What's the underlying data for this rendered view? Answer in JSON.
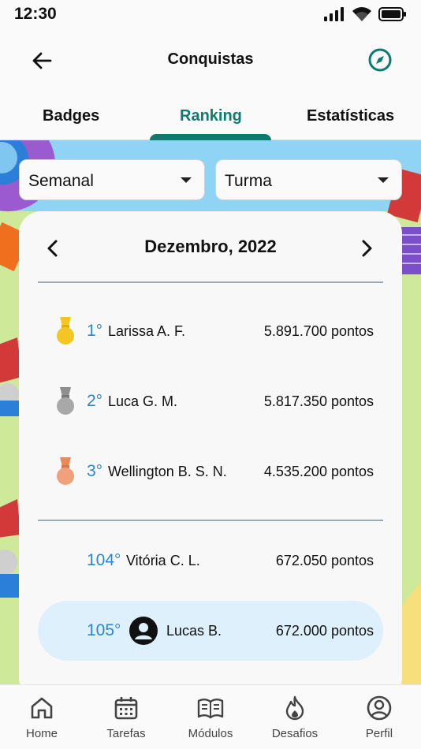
{
  "status_bar": {
    "time": "12:30"
  },
  "app_bar": {
    "title": "Conquistas"
  },
  "tabs": [
    {
      "label": "Badges",
      "active": false
    },
    {
      "label": "Ranking",
      "active": true
    },
    {
      "label": "Estatísticas",
      "active": false
    }
  ],
  "filters": {
    "period": "Semanal",
    "group": "Turma"
  },
  "ranking": {
    "month": "Dezembro, 2022",
    "top": [
      {
        "position": "1°",
        "name": "Larissa A. F.",
        "points": "5.891.700 pontos",
        "medal": "gold-medal-icon",
        "medal_color": "#f3c623"
      },
      {
        "position": "2°",
        "name": "Luca G. M.",
        "points": "5.817.350 pontos",
        "medal": "silver-medal-icon",
        "medal_color": "#a8a8a8"
      },
      {
        "position": "3°",
        "name": "Wellington B. S. N.",
        "points": "4.535.200 pontos",
        "medal": "bronze-medal-icon",
        "medal_color": "#f0a07a"
      }
    ],
    "others": [
      {
        "position": "104°",
        "name": "Vitória C. L.",
        "points": "672.050 pontos"
      },
      {
        "position": "105°",
        "name": "Lucas B.",
        "points": "672.000 pontos",
        "current_user": true
      }
    ]
  },
  "bottom_nav": [
    {
      "label": "Home",
      "icon": "home-icon"
    },
    {
      "label": "Tarefas",
      "icon": "calendar-icon"
    },
    {
      "label": "Módulos",
      "icon": "book-icon"
    },
    {
      "label": "Desafios",
      "icon": "flame-icon"
    },
    {
      "label": "Perfil",
      "icon": "profile-icon"
    }
  ],
  "colors": {
    "accent": "#0e7a70",
    "rank_blue": "#2a87cf",
    "highlight": "#def0fb"
  }
}
